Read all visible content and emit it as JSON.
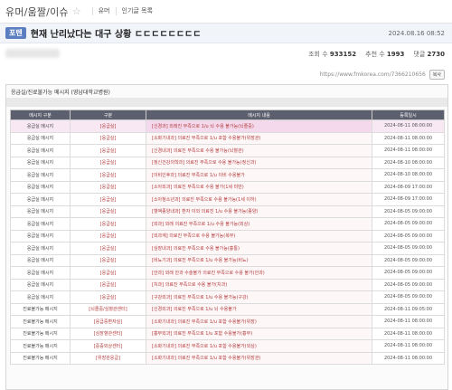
{
  "board": {
    "title": "유머/움짤/이슈",
    "star_icon": "star-outline-icon",
    "tabs": [
      "유머",
      "인기글 목록"
    ]
  },
  "post": {
    "category": "포텐",
    "title": "현재 난리났다는 대구 상황 ㄷㄷㄷㄷㄷㄷㄷㄷ",
    "date": "2024.08.16 08:52",
    "views_label": "조회 수",
    "views": "933152",
    "likes_label": "추천 수",
    "likes": "1993",
    "comments_label": "댓글",
    "comments": "2730",
    "url": "https://www.fmkorea.com/7366210656",
    "copy_label": "복사"
  },
  "frame": {
    "title": "응급실/진료불가능 메시지 (영남대학교병원)"
  },
  "table": {
    "headers": [
      "메시지 구분",
      "구분",
      "메시지 내용",
      "등록일시"
    ],
    "rows": [
      {
        "kind": "응급실 메시지",
        "type": "[응급실]",
        "content": "[신경과] 외래진 부족으로 1/u 뇌 수용 불가능(뇌졸중)",
        "when": "2024-08-11 08:00:00",
        "hl": true
      },
      {
        "kind": "응급실 메시지",
        "type": "[응급실]",
        "content": "[소화기내과] 의료진 부족으로 1/u 포함 수용불가(위장관)",
        "when": "2024-08-11 08:00:00",
        "hl": false
      },
      {
        "kind": "응급실 메시지",
        "type": "[응급실]",
        "content": "[신경내과] 의료진 부족으로 수용 불가능(뇌혈관)",
        "when": "2024-08-11 08:00:00",
        "hl": false
      },
      {
        "kind": "응급실 메시지",
        "type": "[응급실]",
        "content": "[정신건강의학과] 의료진 부족으로 수용 불가능(정신과)",
        "when": "2024-08-10 08:00:00",
        "hl": false
      },
      {
        "kind": "응급실 메시지",
        "type": "[응급실]",
        "content": "[이비인후과] 의료진 부족으로 1/u 이비 수용불가",
        "when": "2024-08-10 08:00:00",
        "hl": false
      },
      {
        "kind": "응급실 메시지",
        "type": "[응급실]",
        "content": "[소아외과] 의료진 부족으로 수용 불가(1세 미만)",
        "when": "2024-08-09 17:00:00",
        "hl": false
      },
      {
        "kind": "응급실 메시지",
        "type": "[응급실]",
        "content": "[소아청소년과] 의료진 부족으로 수용 불가능(1세 이하)",
        "when": "2024-08-09 17:00:00",
        "hl": false
      },
      {
        "kind": "응급실 메시지",
        "type": "[응급실]",
        "content": "[혈액종양내과] 환자 이외 의료진 1/u 수용 불가능(종양)",
        "when": "2024-08-05 09:00:00",
        "hl": false
      },
      {
        "kind": "응급실 메시지",
        "type": "[응급실]",
        "content": "[외과] 외래 의료진 부족으로 1/u 수용 불가능(외상)",
        "when": "2024-08-05 09:00:00",
        "hl": false
      },
      {
        "kind": "응급실 메시지",
        "type": "[응급실]",
        "content": "[외과계] 의료진 부족으로 수용 불가능(복부)",
        "when": "2024-08-05 09:00:00",
        "hl": false
      },
      {
        "kind": "응급실 메시지",
        "type": "[응급실]",
        "content": "[심장내과] 의료진 부족으로 수용 불가능(흉통)",
        "when": "2024-08-05 09:00:00",
        "hl": false
      },
      {
        "kind": "응급실 메시지",
        "type": "[응급실]",
        "content": "[비뇨기과] 의료진 부족으로 1/u 수용 불가능(비뇨)",
        "when": "2024-08-05 09:00:00",
        "hl": false
      },
      {
        "kind": "응급실 메시지",
        "type": "[응급실]",
        "content": "[안과] 외래 안과 수술불가 의료진 부족으로 수용 불가(안과)",
        "when": "2024-08-05 09:00:00",
        "hl": false
      },
      {
        "kind": "응급실 메시지",
        "type": "[응급실]",
        "content": "[치과] 의료진 부족으로 수용 불가(치과)",
        "when": "2024-08-05 09:00:00",
        "hl": false
      },
      {
        "kind": "응급실 메시지",
        "type": "[응급실]",
        "content": "[구강외과] 의료진 부족으로 1/u 수용 불가능(구강)",
        "when": "2024-08-05 09:00:00",
        "hl": false
      },
      {
        "kind": "진료불가능 메시지",
        "type": "[뇌졸중/심혈관센터]",
        "content": "[신경외과] 의료진 부족으로 1/u 뇌 수용불가",
        "when": "2024-08-11 09:05:00",
        "hl": false
      },
      {
        "kind": "진료불가능 메시지",
        "type": "[응급중환자실]",
        "content": "[소화기내과] 의료진 부족으로 1/u 포함 수용불가(위장)",
        "when": "2024-08-11 08:00:00",
        "hl": false
      },
      {
        "kind": "진료불가능 메시지",
        "type": "[심장혈관센터]",
        "content": "[흉부외과] 의료진 부족으로 1/u 포함 수용불가(흉부)",
        "when": "2024-08-11 08:00:00",
        "hl": false
      },
      {
        "kind": "진료불가능 메시지",
        "type": "[중증외상센터]",
        "content": "[소화기내과] 의료진 부족으로 1/u 포함 수용불가(외상)",
        "when": "2024-08-11 08:00:00",
        "hl": false
      },
      {
        "kind": "진료불가능 메시지",
        "type": "[위장관응급]",
        "content": "[소화기내과] 의료진 부족으로 1/u 포함 수용불가(위장관)",
        "when": "2024-08-11 08:00:00",
        "hl": false
      }
    ]
  },
  "colors": {
    "accent": "#5a7ec0",
    "header_bg": "#5b5f6e",
    "highlight": "#f7e8f3",
    "type_text": "#b33a3a"
  }
}
